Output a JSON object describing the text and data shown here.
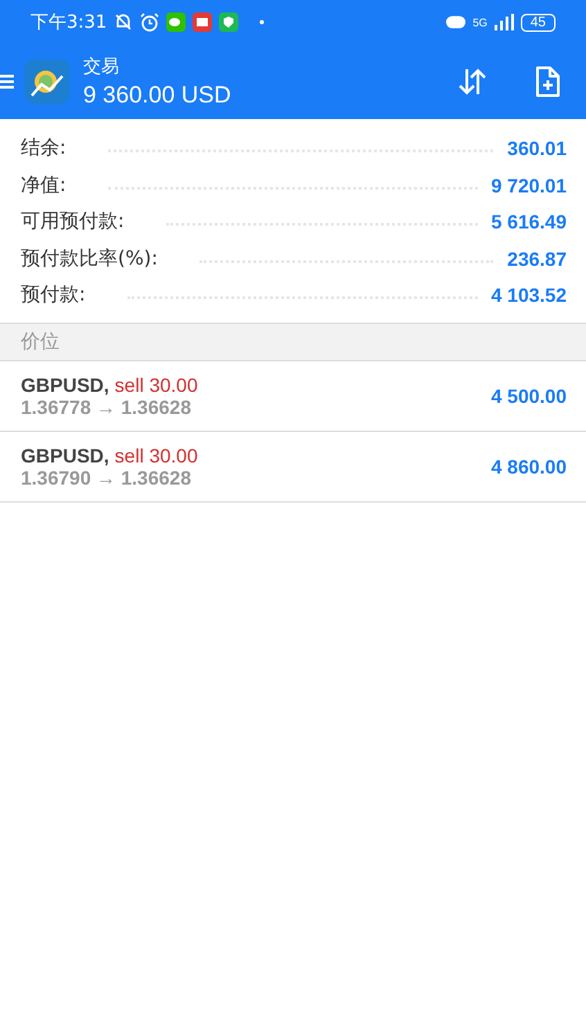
{
  "status_bar": {
    "time": "下午3:31",
    "network": "5G",
    "battery": "45"
  },
  "header": {
    "title": "交易",
    "balance": "9 360.00 USD"
  },
  "summary": [
    {
      "label": "结余:",
      "value": "360.01"
    },
    {
      "label": "净值:",
      "value": "9 720.01"
    },
    {
      "label": "可用预付款:",
      "value": "5 616.49"
    },
    {
      "label": "预付款比率(%):",
      "value": "236.87"
    },
    {
      "label": "预付款:",
      "value": "4 103.52"
    }
  ],
  "section": {
    "title": "价位"
  },
  "positions": [
    {
      "symbol": "GBPUSD,",
      "action": "sell 30.00",
      "prices": "1.36778 → 1.36628",
      "profit": "4 500.00"
    },
    {
      "symbol": "GBPUSD,",
      "action": "sell 30.00",
      "prices": "1.36790 → 1.36628",
      "profit": "4 860.00"
    }
  ]
}
